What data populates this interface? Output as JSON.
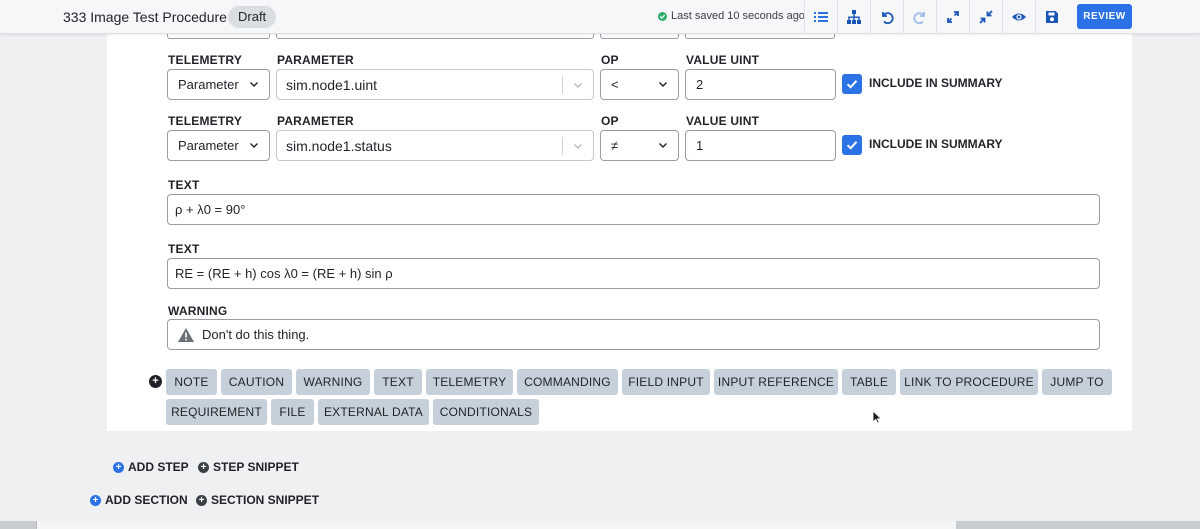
{
  "header": {
    "title": "333 Image Test Procedure",
    "status_badge": "Draft",
    "saved_text": "Last saved 10 seconds ago",
    "review_label": "REVIEW",
    "toolbar_icons": [
      "list-icon",
      "hierarchy-icon",
      "undo-icon",
      "redo-icon",
      "expand-icon",
      "collapse-icon",
      "eye-icon",
      "save-icon"
    ]
  },
  "telemetry_rows": [
    {
      "telemetry_label": "TELEMETRY",
      "telemetry_value": "Parameter",
      "parameter_label": "PARAMETER",
      "parameter_value": "sim.node1.uint",
      "op_label": "OP",
      "op_value": "<",
      "value_label": "VALUE UINT",
      "value": "2",
      "include_label": "INCLUDE IN SUMMARY",
      "include_checked": true
    },
    {
      "telemetry_label": "TELEMETRY",
      "telemetry_value": "Parameter",
      "parameter_label": "PARAMETER",
      "parameter_value": "sim.node1.status",
      "op_label": "OP",
      "op_value": "≠",
      "value_label": "VALUE UINT",
      "value": "1",
      "include_label": "INCLUDE IN SUMMARY",
      "include_checked": true
    }
  ],
  "text_blocks": [
    {
      "label": "TEXT",
      "value": "ρ + λ0 = 90°"
    },
    {
      "label": "TEXT",
      "value": "RE = (RE + h) cos λ0 = (RE + h) sin ρ"
    }
  ],
  "warning_block": {
    "label": "WARNING",
    "value": "Don't do this thing."
  },
  "add_content_chips": [
    "NOTE",
    "CAUTION",
    "WARNING",
    "TEXT",
    "TELEMETRY",
    "COMMANDING",
    "FIELD INPUT",
    "INPUT REFERENCE",
    "TABLE",
    "LINK TO PROCEDURE",
    "JUMP TO",
    "REQUIREMENT",
    "FILE",
    "EXTERNAL DATA",
    "CONDITIONALS"
  ],
  "step_actions": {
    "add_step": "ADD STEP",
    "step_snippet": "STEP SNIPPET"
  },
  "section_actions": {
    "add_section": "ADD SECTION",
    "section_snippet": "SECTION SNIPPET"
  },
  "colors": {
    "accent": "#2a72e5",
    "chip_bg": "#c6d0da",
    "saved_dot": "#2fae6a"
  }
}
